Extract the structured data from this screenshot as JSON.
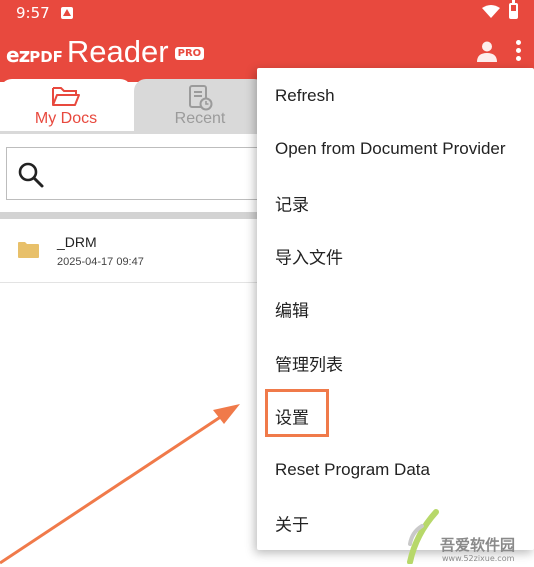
{
  "status_bar": {
    "time": "9:57"
  },
  "app_bar": {
    "logo_ez": "ez",
    "logo_pdf": "PDF",
    "logo_reader": "Reader",
    "pro_badge": "PRO",
    "icons": [
      "user-icon",
      "more-vert-icon"
    ]
  },
  "tabs": [
    {
      "label": "My Docs",
      "icon": "folder-open-icon",
      "active": true
    },
    {
      "label": "Recent",
      "icon": "recent-doc-icon",
      "active": false
    }
  ],
  "search": {
    "icon": "search-icon",
    "placeholder": ""
  },
  "files": [
    {
      "name": "_DRM",
      "date": "2025-04-17 09:47",
      "icon": "folder-icon"
    }
  ],
  "menu": {
    "items": [
      {
        "label": "Refresh"
      },
      {
        "label": "Open from Document Provider"
      },
      {
        "label": "记录"
      },
      {
        "label": "导入文件"
      },
      {
        "label": "编辑"
      },
      {
        "label": "管理列表"
      },
      {
        "label": "设置",
        "highlighted": true
      },
      {
        "label": "Reset Program Data"
      },
      {
        "label": "关于"
      }
    ]
  },
  "watermark": {
    "text": "吾爱软件园",
    "site": "www.52zixue.com"
  },
  "colors": {
    "brand_red": "#e8493e",
    "highlight_orange": "#f07a4a",
    "folder_yellow": "#e8c06a"
  }
}
